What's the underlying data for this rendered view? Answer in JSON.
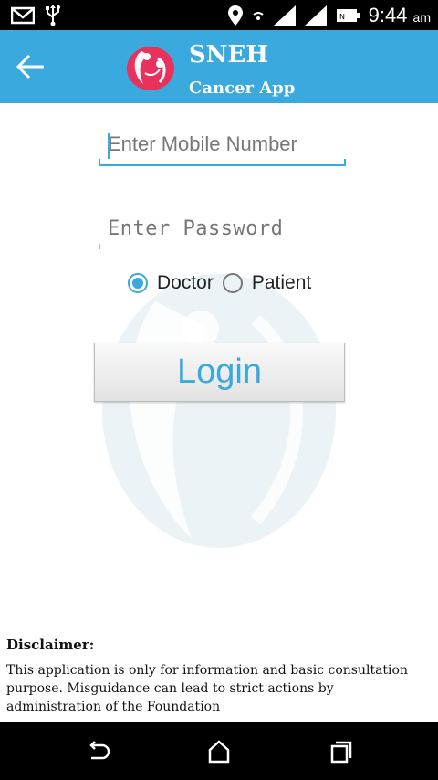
{
  "status_bar": {
    "time": "9:44",
    "ampm": "am",
    "icons": [
      "gmail-icon",
      "usb-icon",
      "location-icon",
      "wifi-icon",
      "signal-icon",
      "signal-icon",
      "battery-icon"
    ]
  },
  "app_bar": {
    "title": "SNEH",
    "subtitle": "Cancer App",
    "background": "#3aa9dd"
  },
  "form": {
    "mobile_placeholder": "Enter Mobile Number",
    "password_placeholder": "Enter Password",
    "role_options": [
      {
        "label": "Doctor",
        "selected": true
      },
      {
        "label": "Patient",
        "selected": false
      }
    ],
    "login_label": "Login"
  },
  "disclaimer": {
    "title": "Disclaimer:",
    "text": "This application is only for information and basic consultation purpose. Misguidance can lead to strict actions by administration of the Foundation"
  },
  "accent_color": "#3aa9dd"
}
